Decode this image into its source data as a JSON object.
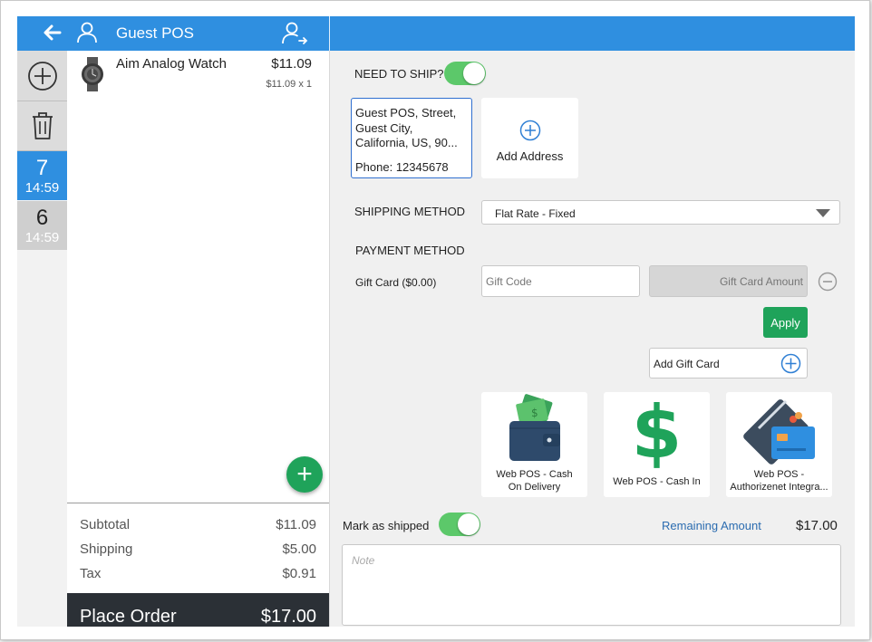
{
  "header": {
    "customer_name": "Guest POS"
  },
  "rail": {
    "orders": [
      {
        "number": "7",
        "time": "14:59",
        "active": true
      },
      {
        "number": "6",
        "time": "14:59",
        "active": false
      }
    ]
  },
  "cart": {
    "items": [
      {
        "name": "Aim Analog Watch",
        "price": "$11.09",
        "qty_line": "$11.09 x 1"
      }
    ],
    "totals": {
      "subtotal_label": "Subtotal",
      "subtotal": "$11.09",
      "shipping_label": "Shipping",
      "shipping": "$5.00",
      "tax_label": "Tax",
      "tax": "$0.91"
    },
    "place_order_label": "Place Order",
    "place_order_amount": "$17.00"
  },
  "checkout": {
    "need_to_ship_label": "NEED TO SHIP?",
    "address": {
      "line1": "Guest POS, Street,",
      "line2": "Guest City,",
      "line3": "California, US, 90...",
      "phone": "Phone: 12345678"
    },
    "add_address_label": "Add Address",
    "shipping_method_label": "SHIPPING METHOD",
    "shipping_method_value": "Flat Rate - Fixed",
    "payment_method_label": "PAYMENT METHOD",
    "gift_card_label": "Gift Card ($0.00)",
    "gift_code_placeholder": "Gift Code",
    "gift_amount_placeholder": "Gift Card Amount",
    "apply_label": "Apply",
    "add_gift_card_label": "Add Gift Card",
    "payment_options": [
      {
        "label_line1": "Web POS - Cash",
        "label_line2": "On Delivery",
        "icon": "wallet-icon"
      },
      {
        "label_line1": "Web POS - Cash In",
        "label_line2": "",
        "icon": "dollar-icon"
      },
      {
        "label_line1": "Web POS -",
        "label_line2": "Authorizenet Integra...",
        "icon": "credit-cards-icon"
      }
    ],
    "mark_as_shipped_label": "Mark as shipped",
    "remaining_label": "Remaining Amount",
    "remaining_amount": "$17.00",
    "note_placeholder": "Note"
  },
  "colors": {
    "header": "#2f8fe0",
    "accent_green": "#1fa35a",
    "toggle_green": "#5cc86a",
    "place_order_bg": "#2b3036"
  }
}
